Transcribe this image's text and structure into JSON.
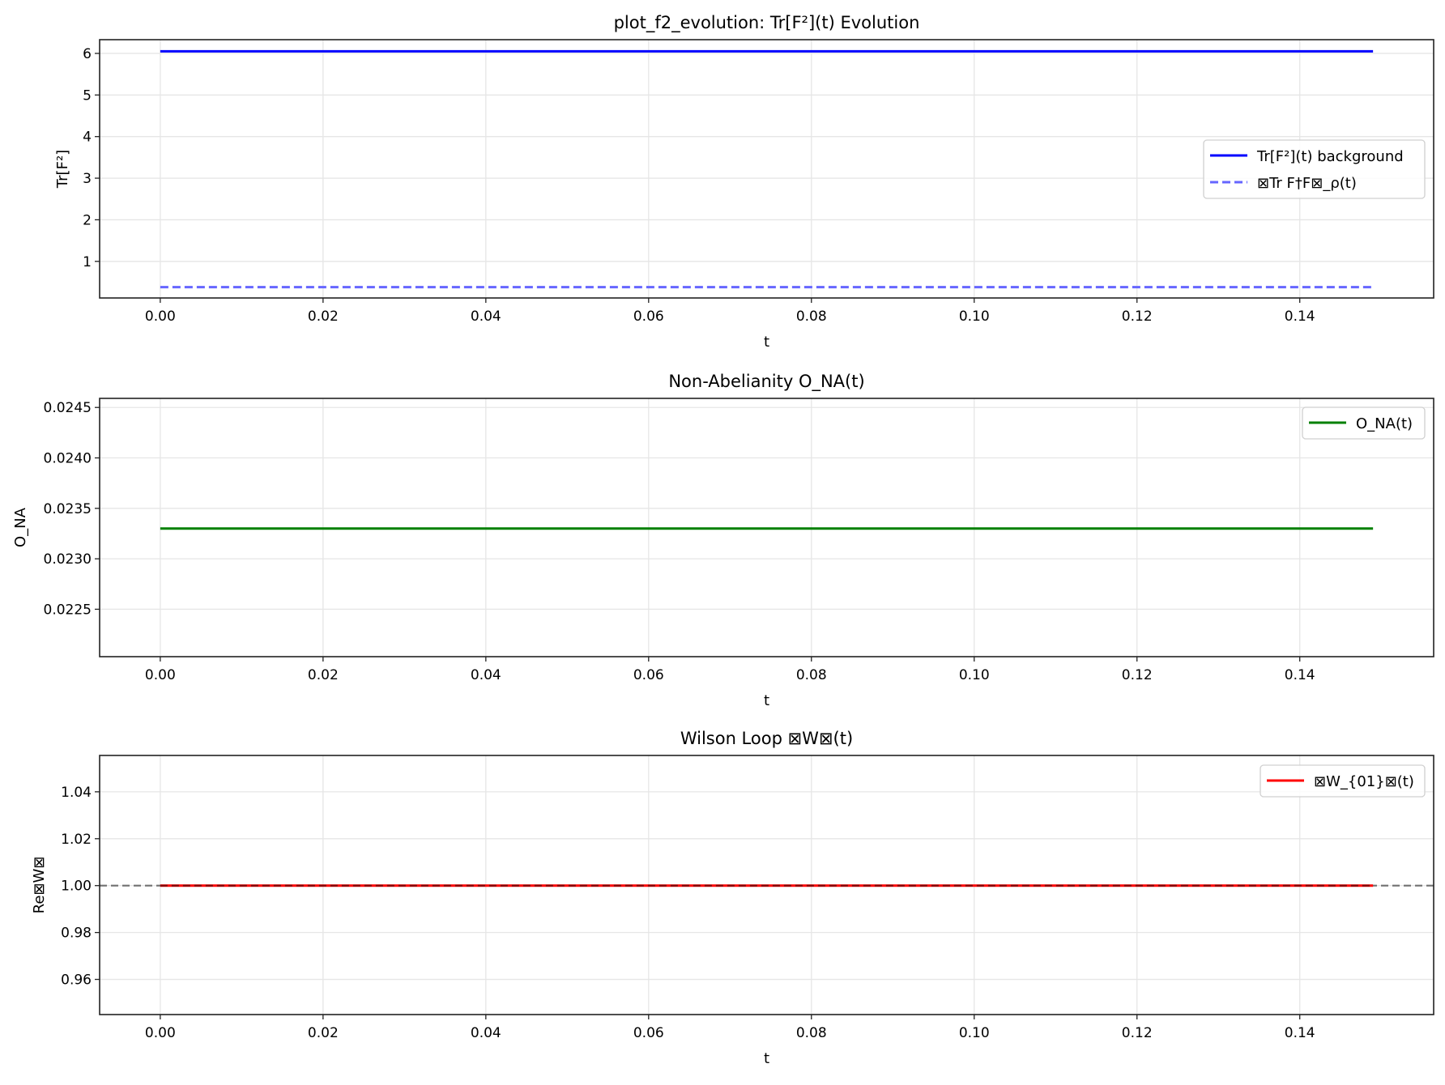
{
  "chart_data": [
    {
      "type": "line",
      "title": "plot_f2_evolution: Tr[F²](t) Evolution",
      "xlabel": "t",
      "ylabel": "Tr[F²]",
      "xlim": [
        -0.00745,
        0.15645
      ],
      "ylim": [
        0.12,
        6.33
      ],
      "xticks": [
        0.0,
        0.02,
        0.04,
        0.06,
        0.08,
        0.1,
        0.12,
        0.14
      ],
      "xtick_labels": [
        "0.00",
        "0.02",
        "0.04",
        "0.06",
        "0.08",
        "0.10",
        "0.12",
        "0.14"
      ],
      "yticks": [
        1,
        2,
        3,
        4,
        5,
        6
      ],
      "ytick_labels": [
        "1",
        "2",
        "3",
        "4",
        "5",
        "6"
      ],
      "grid": true,
      "legend_placement": "center-right",
      "series": [
        {
          "name": "Tr[F²](t) background",
          "x": [
            0.0,
            0.149
          ],
          "y": [
            6.05,
            6.05
          ],
          "color": "#0000ff",
          "style": "solid"
        },
        {
          "name": "⊠Tr F†F⊠_ρ(t)",
          "x": [
            0.0,
            0.149
          ],
          "y": [
            0.38,
            0.38
          ],
          "color": "#6666ff",
          "style": "dashed"
        }
      ],
      "hlines": []
    },
    {
      "type": "line",
      "title": "Non-Abelianity O_NA(t)",
      "xlabel": "t",
      "ylabel": "O_NA",
      "xlim": [
        -0.00745,
        0.15645
      ],
      "ylim": [
        0.02203,
        0.02459
      ],
      "xticks": [
        0.0,
        0.02,
        0.04,
        0.06,
        0.08,
        0.1,
        0.12,
        0.14
      ],
      "xtick_labels": [
        "0.00",
        "0.02",
        "0.04",
        "0.06",
        "0.08",
        "0.10",
        "0.12",
        "0.14"
      ],
      "yticks": [
        0.0225,
        0.023,
        0.0235,
        0.024,
        0.0245
      ],
      "ytick_labels": [
        "0.0225",
        "0.0230",
        "0.0235",
        "0.0240",
        "0.0245"
      ],
      "grid": true,
      "legend_placement": "upper-right",
      "series": [
        {
          "name": "O_NA(t)",
          "x": [
            0.0,
            0.149
          ],
          "y": [
            0.0233,
            0.0233
          ],
          "color": "#008000",
          "style": "solid"
        }
      ],
      "hlines": []
    },
    {
      "type": "line",
      "title": "Wilson Loop ⊠W⊠(t)",
      "xlabel": "t",
      "ylabel": "Re⊠W⊠",
      "xlim": [
        -0.00745,
        0.15645
      ],
      "ylim": [
        0.945,
        1.0555
      ],
      "xticks": [
        0.0,
        0.02,
        0.04,
        0.06,
        0.08,
        0.1,
        0.12,
        0.14
      ],
      "xtick_labels": [
        "0.00",
        "0.02",
        "0.04",
        "0.06",
        "0.08",
        "0.10",
        "0.12",
        "0.14"
      ],
      "yticks": [
        0.96,
        0.98,
        1.0,
        1.02,
        1.04
      ],
      "ytick_labels": [
        "0.96",
        "0.98",
        "1.00",
        "1.02",
        "1.04"
      ],
      "grid": true,
      "legend_placement": "upper-right",
      "series": [
        {
          "name": "⊠W_{01}⊠(t)",
          "x": [
            0.0,
            0.149
          ],
          "y": [
            1.0,
            1.0
          ],
          "color": "#ff0000",
          "style": "solid"
        }
      ],
      "hlines": [
        {
          "y": 1.0,
          "color": "#000000",
          "style": "dashed"
        }
      ]
    }
  ]
}
